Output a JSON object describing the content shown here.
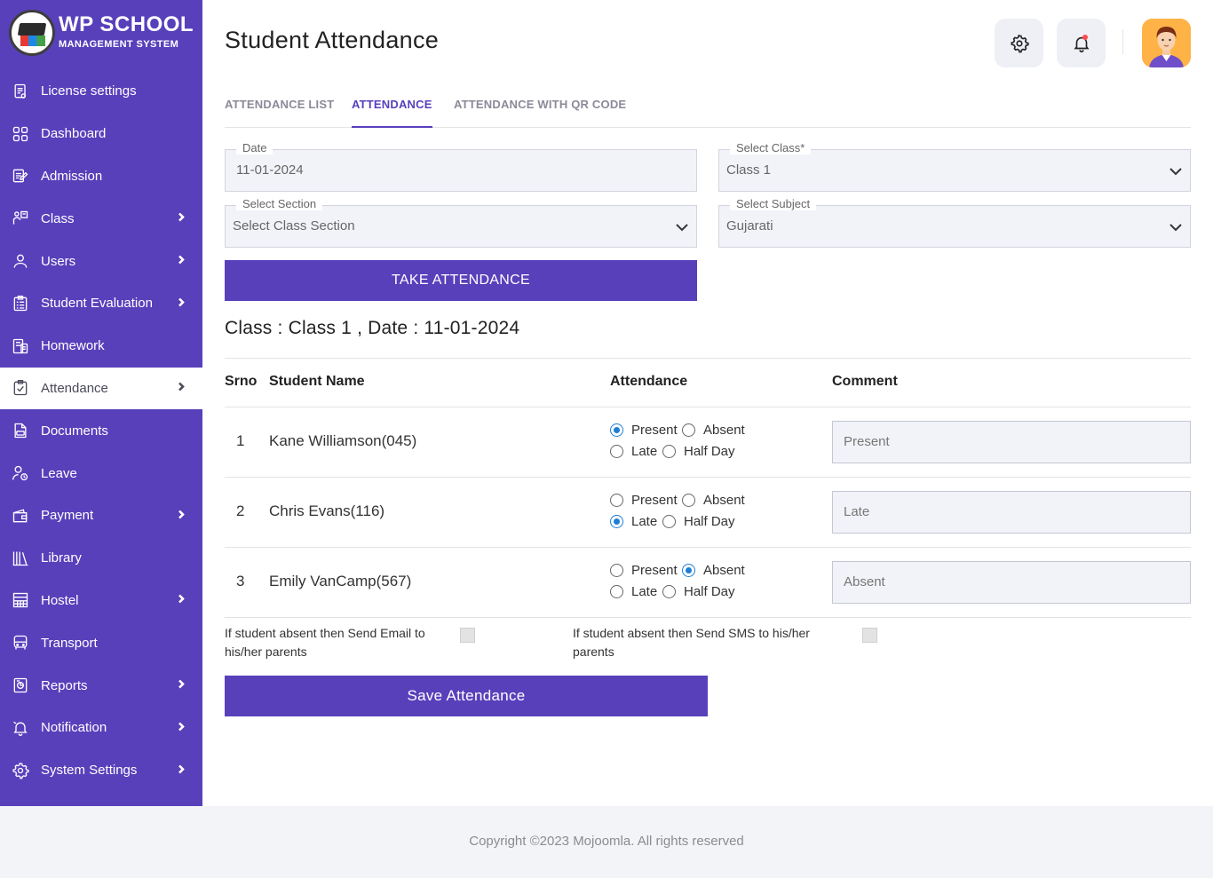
{
  "brand": {
    "title": "WP SCHOOL",
    "subtitle": "MANAGEMENT SYSTEM"
  },
  "sidebar": {
    "items": [
      {
        "label": "License settings",
        "icon": "license-icon",
        "chevron": false,
        "active": false
      },
      {
        "label": "Dashboard",
        "icon": "dashboard-icon",
        "chevron": false,
        "active": false
      },
      {
        "label": "Admission",
        "icon": "admission-icon",
        "chevron": false,
        "active": false
      },
      {
        "label": "Class",
        "icon": "class-icon",
        "chevron": true,
        "active": false
      },
      {
        "label": "Users",
        "icon": "user-icon",
        "chevron": true,
        "active": false
      },
      {
        "label": "Student Evaluation",
        "icon": "evaluation-icon",
        "chevron": true,
        "active": false
      },
      {
        "label": "Homework",
        "icon": "homework-icon",
        "chevron": false,
        "active": false
      },
      {
        "label": "Attendance",
        "icon": "attendance-icon",
        "chevron": true,
        "active": true
      },
      {
        "label": "Documents",
        "icon": "documents-icon",
        "chevron": false,
        "active": false
      },
      {
        "label": "Leave",
        "icon": "leave-icon",
        "chevron": false,
        "active": false
      },
      {
        "label": "Payment",
        "icon": "wallet-icon",
        "chevron": true,
        "active": false
      },
      {
        "label": "Library",
        "icon": "library-icon",
        "chevron": false,
        "active": false
      },
      {
        "label": "Hostel",
        "icon": "hostel-icon",
        "chevron": true,
        "active": false
      },
      {
        "label": "Transport",
        "icon": "bus-icon",
        "chevron": false,
        "active": false
      },
      {
        "label": "Reports",
        "icon": "reports-icon",
        "chevron": true,
        "active": false
      },
      {
        "label": "Notification",
        "icon": "notification-icon",
        "chevron": true,
        "active": false
      },
      {
        "label": "System Settings",
        "icon": "gear-icon",
        "chevron": true,
        "active": false
      }
    ]
  },
  "header": {
    "title": "Student Attendance",
    "settings_icon": "gear-icon",
    "bell_icon": "bell-icon",
    "avatar_icon": "avatar"
  },
  "tabs": [
    {
      "label": "ATTENDANCE LIST",
      "active": false
    },
    {
      "label": "ATTENDANCE",
      "active": true
    },
    {
      "label": "ATTENDANCE WITH QR CODE",
      "active": false
    }
  ],
  "form": {
    "date": {
      "label": "Date",
      "value": "11-01-2024"
    },
    "class": {
      "label": "Select Class*",
      "value": "Class 1"
    },
    "section": {
      "label": "Select Section",
      "value": "Select Class Section"
    },
    "subject": {
      "label": "Select Subject",
      "value": "Gujarati"
    },
    "take_button": "TAKE ATTENDANCE"
  },
  "summary": "Class : Class 1 , Date : 11-01-2024",
  "table": {
    "headers": {
      "srno": "Srno",
      "name": "Student Name",
      "attendance": "Attendance",
      "comment": "Comment"
    },
    "options": {
      "present": "Present",
      "absent": "Absent",
      "late": "Late",
      "halfday": "Half Day"
    },
    "rows": [
      {
        "srno": "1",
        "name": "Kane Williamson(045)",
        "status": "present",
        "comment": "Present"
      },
      {
        "srno": "2",
        "name": "Chris Evans(116)",
        "status": "late",
        "comment": "Late"
      },
      {
        "srno": "3",
        "name": "Emily VanCamp(567)",
        "status": "absent",
        "comment": "Absent"
      }
    ]
  },
  "notify": {
    "email_line1": "If student absent then Send Email to",
    "email_line2": "his/her parents",
    "sms_line1": "If student absent then Send SMS to his/her",
    "sms_line2": "parents",
    "email_checked": false,
    "sms_checked": false
  },
  "save_button": "Save Attendance",
  "footer": {
    "copyright": "Copyright ©2023 Mojoomla. All rights reserved"
  },
  "colors": {
    "primary": "#5840bb",
    "radio": "#1c7ed6",
    "field_bg": "#f2f3f8"
  }
}
